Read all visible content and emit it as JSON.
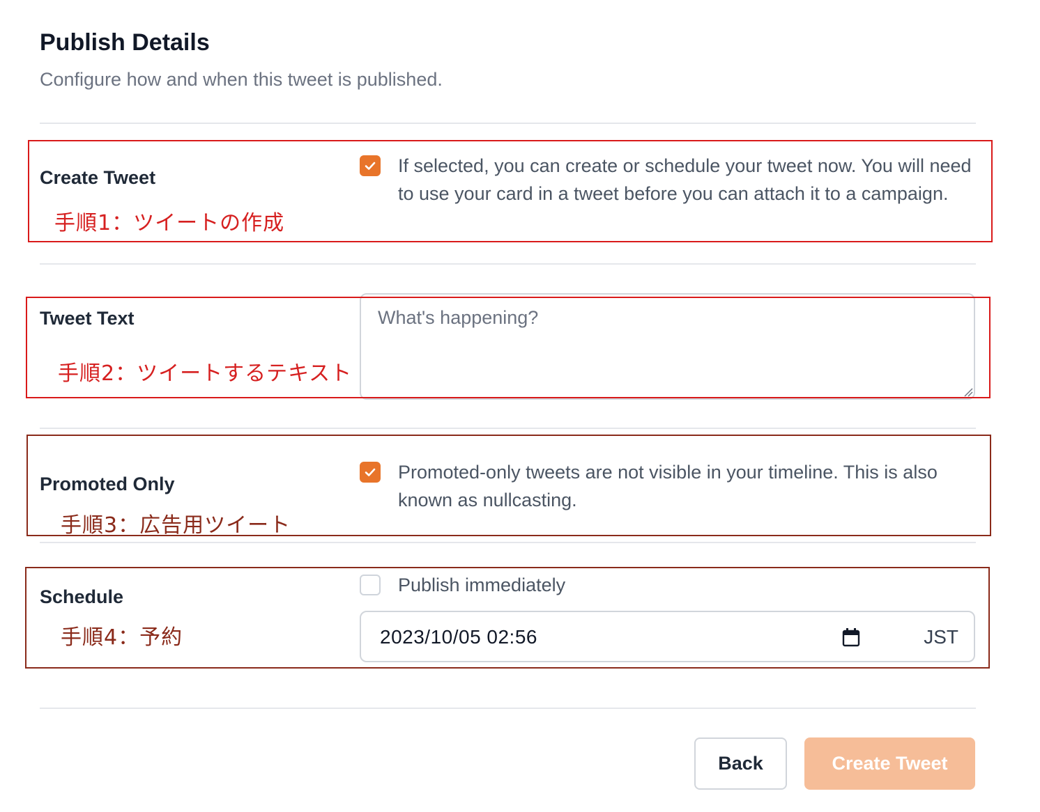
{
  "header": {
    "title": "Publish Details",
    "subtitle": "Configure how and when this tweet is published."
  },
  "create_tweet": {
    "label": "Create Tweet",
    "annotation": "手順1：ツイートの作成",
    "checked": true,
    "help_text": "If selected, you can create or schedule your tweet now. You will need to use your card in a tweet before you can attach it to a campaign."
  },
  "tweet_text": {
    "label": "Tweet Text",
    "annotation": "手順2：ツイートするテキスト",
    "placeholder": "What's happening?",
    "value": ""
  },
  "promoted_only": {
    "label": "Promoted Only",
    "annotation": "手順3：広告用ツイート",
    "checked": true,
    "help_text": "Promoted-only tweets are not visible in your timeline. This is also known as nullcasting."
  },
  "schedule": {
    "label": "Schedule",
    "annotation": "手順4：予約",
    "publish_immediately_label": "Publish immediately",
    "publish_immediately_checked": false,
    "datetime_value": "2023/10/05 02:56",
    "timezone": "JST",
    "calendar_icon": "calendar-icon"
  },
  "footer": {
    "back_label": "Back",
    "create_label": "Create Tweet"
  },
  "colors": {
    "accent": "#e8742a",
    "create_button_disabled": "#f6bd98",
    "annotation_red": "#d91a1a",
    "annotation_dark": "#8a2a1a"
  }
}
